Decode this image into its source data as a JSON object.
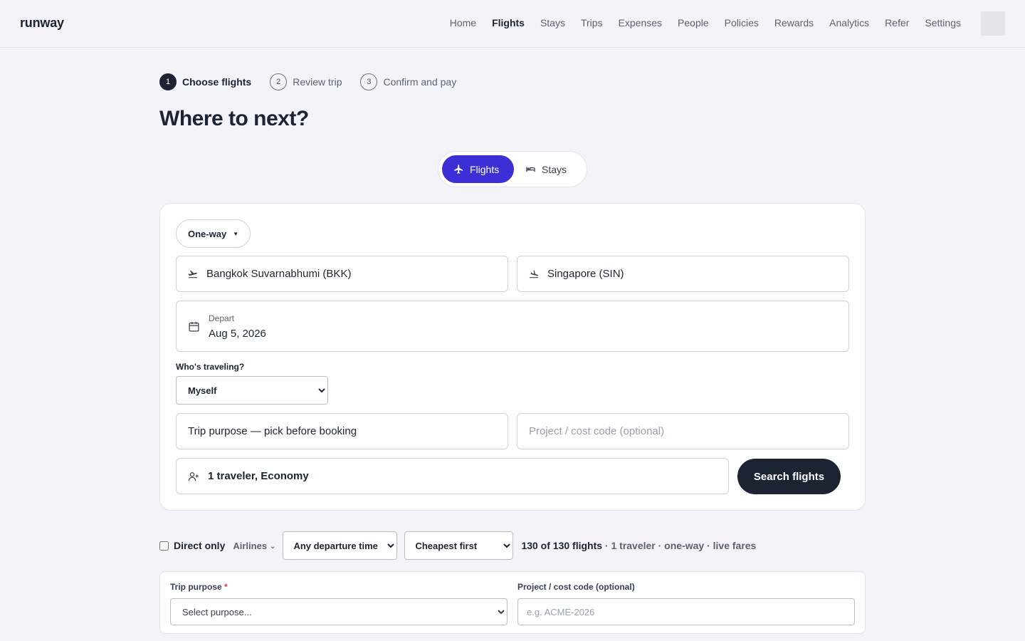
{
  "header": {
    "brand": "runway",
    "nav": [
      "Home",
      "Flights",
      "Stays",
      "Trips",
      "Expenses",
      "People",
      "Policies",
      "Rewards",
      "Analytics",
      "Refer",
      "Settings"
    ],
    "active_nav": "Flights"
  },
  "steps": [
    {
      "num": "1",
      "label": "Choose flights",
      "active": true
    },
    {
      "num": "2",
      "label": "Review trip",
      "active": false
    },
    {
      "num": "3",
      "label": "Confirm and pay",
      "active": false
    }
  ],
  "page_title": "Where to next?",
  "mode_toggle": {
    "flights": "Flights",
    "stays": "Stays",
    "active": "Flights",
    "accent_color": "#3d2fd6"
  },
  "search": {
    "trip_type": "One-way",
    "from": "Bangkok Suvarnabhumi (BKK)",
    "to": "Singapore (SIN)",
    "depart_label": "Depart",
    "depart_date": "Aug 5, 2026",
    "who_label": "Who's traveling?",
    "who_value": "Myself",
    "purpose": "Trip purpose — pick before booking",
    "cost_placeholder": "Project / cost code (optional)",
    "travelers": "1 traveler, Economy",
    "search_button": "Search flights"
  },
  "filters": {
    "direct_only": "Direct only",
    "airlines": "Airlines",
    "departure_time": "Any departure time",
    "sort": "Cheapest first",
    "count": "130 of 130 flights",
    "meta": " · 1 traveler · one-way · live fares"
  },
  "purpose_card": {
    "purpose_label": "Trip purpose",
    "required_mark": "*",
    "purpose_select": "Select purpose...",
    "cost_label": "Project / cost code (optional)",
    "cost_placeholder": "e.g. ACME-2026"
  }
}
